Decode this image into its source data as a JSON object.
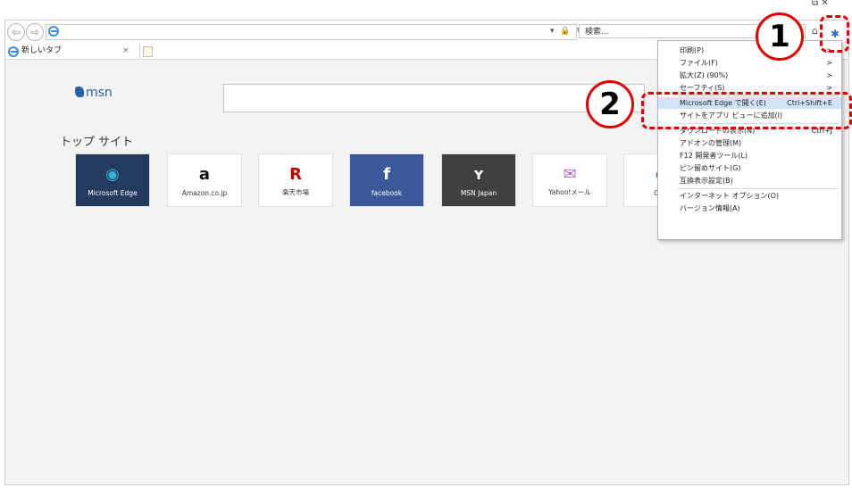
{
  "browser": {
    "search_placeholder": "検索...",
    "tab_label": "新しいタブ",
    "tab_close": "×",
    "back_glyph": "⇦",
    "forward_glyph": "⇨",
    "addr_icons": "▾ 🔒 ↻",
    "gear_glyph": "✱",
    "home_glyph": "⌂",
    "win_ctrl": "⧉ ✕"
  },
  "page": {
    "msn_logo": "msn",
    "top_sites_heading": "トップ サイト",
    "tiles": [
      {
        "label": "Microsoft Edge",
        "icon": "◉",
        "bg": "#243a5e",
        "fg": "#2fb4d9"
      },
      {
        "label": "Amazon.co.jp",
        "icon": "a",
        "bg": "#ffffff",
        "fg": "#111111"
      },
      {
        "label": "楽天市場",
        "icon": "R",
        "bg": "#ffffff",
        "fg": "#bf0000"
      },
      {
        "label": "facebook",
        "icon": "f",
        "bg": "#3b5998",
        "fg": "#ffffff"
      },
      {
        "label": "MSN Japan",
        "icon": "ʏ",
        "bg": "#404040",
        "fg": "#ffffff"
      },
      {
        "label": "Yahoo!メール",
        "icon": "✉",
        "bg": "#ffffff",
        "fg": "#b066c8"
      },
      {
        "label": "Outl",
        "icon": "e",
        "bg": "#ffffff",
        "fg": "#1f7ad6"
      }
    ]
  },
  "menu": {
    "items": [
      {
        "label": "印刷(P)",
        "shortcut": ">"
      },
      {
        "label": "ファイル(F)",
        "shortcut": ">"
      },
      {
        "label": "拡大(Z) (90%)",
        "shortcut": ">"
      },
      {
        "label": "セーフティ(S)",
        "shortcut": ">"
      },
      {
        "label": "Microsoft Edge で開く(E)",
        "shortcut": "Ctrl+Shift+E"
      },
      {
        "label": "サイトをアプリ ビューに追加(I)",
        "shortcut": ""
      },
      {
        "label": "ダウンロードの表示(N)",
        "shortcut": "Ctrl+J"
      },
      {
        "label": "アドオンの管理(M)",
        "shortcut": ""
      },
      {
        "label": "F12 開発者ツール(L)",
        "shortcut": ""
      },
      {
        "label": "ピン留めサイト(G)",
        "shortcut": ""
      },
      {
        "label": "互換表示設定(B)",
        "shortcut": ""
      },
      {
        "label": "インターネット オプション(O)",
        "shortcut": ""
      },
      {
        "label": "バージョン情報(A)",
        "shortcut": ""
      }
    ]
  },
  "annotations": {
    "step1": "1",
    "step2": "2",
    "accent": "#e00000"
  }
}
